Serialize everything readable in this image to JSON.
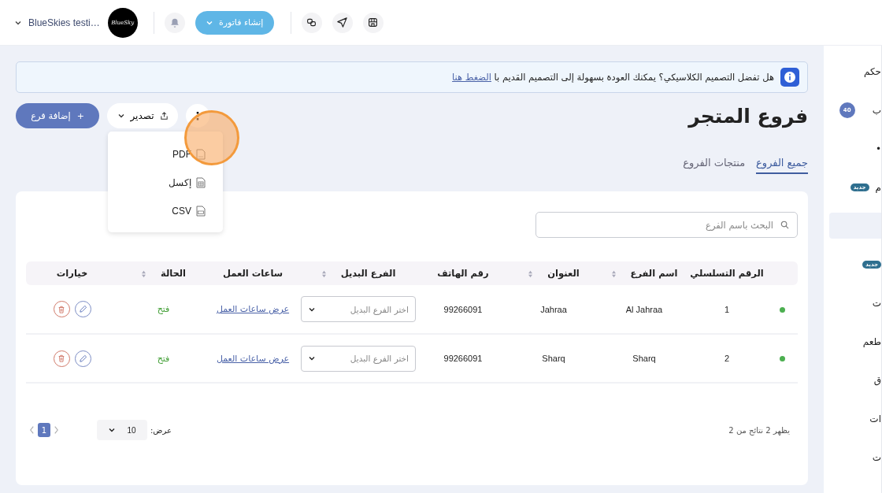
{
  "topbar": {
    "account": "BlueSkies testi…",
    "avatar_text": "BlueSky",
    "create_button": "إنشاء فاتورة"
  },
  "banner": {
    "text": "هل تفضل التصميم الكلاسيكي؟ يمكنك العودة بسهولة إلى التصميم القديم با",
    "link": "الضغط هنا"
  },
  "page": {
    "title": "فروع المتجر",
    "add_button": "إضافة فرع",
    "add_icon": "+",
    "export_button": "تصدير",
    "more_button": "⋮"
  },
  "export_menu": {
    "open": true,
    "items": [
      {
        "label": "PDF",
        "kind": "pdf"
      },
      {
        "label": "إكسل",
        "kind": "excel"
      },
      {
        "label": "CSV",
        "kind": "csv"
      }
    ]
  },
  "tabs": [
    {
      "label": "جميع الفروع",
      "selected": true
    },
    {
      "label": "منتجات الفروع",
      "selected": false
    }
  ],
  "search": {
    "placeholder": "البحث باسم الفرع"
  },
  "table": {
    "columns": [
      {
        "label": "الرقم التسلسلي",
        "sortable": false
      },
      {
        "label": "اسم الفرع",
        "sortable": true
      },
      {
        "label": "العنوان",
        "sortable": true
      },
      {
        "label": "رقم الهاتف",
        "sortable": false
      },
      {
        "label": "الفرع البديل",
        "sortable": true
      },
      {
        "label": "ساعات العمل",
        "sortable": false
      },
      {
        "label": "الحالة",
        "sortable": true
      },
      {
        "label": "خيارات",
        "sortable": false
      }
    ],
    "rows": [
      {
        "color": "#4caf50",
        "serial": "1",
        "name": "Al Jahraa",
        "address": "Jahraa",
        "phone": "99266091",
        "alt_placeholder": "اختر الفرع البديل",
        "hours_link": "عرض ساعات العمل",
        "status": "فتح"
      },
      {
        "color": "#4caf50",
        "serial": "2",
        "name": "Sharq",
        "address": "Sharq",
        "phone": "99266091",
        "alt_placeholder": "اختر الفرع البديل",
        "hours_link": "عرض ساعات العمل",
        "status": "فتح"
      }
    ]
  },
  "footer": {
    "summary": "يظهر 2 نتائج من 2",
    "show_label": "عرض:",
    "page_size": "10",
    "pages": [
      {
        "label": "1",
        "selected": true
      }
    ]
  },
  "sidebar": {
    "items": [
      {
        "label": "حكم",
        "selected": false
      },
      {
        "label": "ب",
        "badge": "40",
        "kind": "count",
        "selected": false
      },
      {
        "label": "•",
        "selected": false
      },
      {
        "label": "م",
        "badge": "جديد",
        "kind": "new",
        "selected": false
      },
      {
        "selected": true
      },
      {
        "badge": "جديد",
        "kind": "new",
        "selected": false
      },
      {
        "label": "ت",
        "selected": false
      },
      {
        "label": "طعم",
        "selected": false
      },
      {
        "label": "ق",
        "selected": false
      },
      {
        "label": "ات",
        "selected": false
      },
      {
        "label": "ت",
        "selected": false
      }
    ]
  }
}
